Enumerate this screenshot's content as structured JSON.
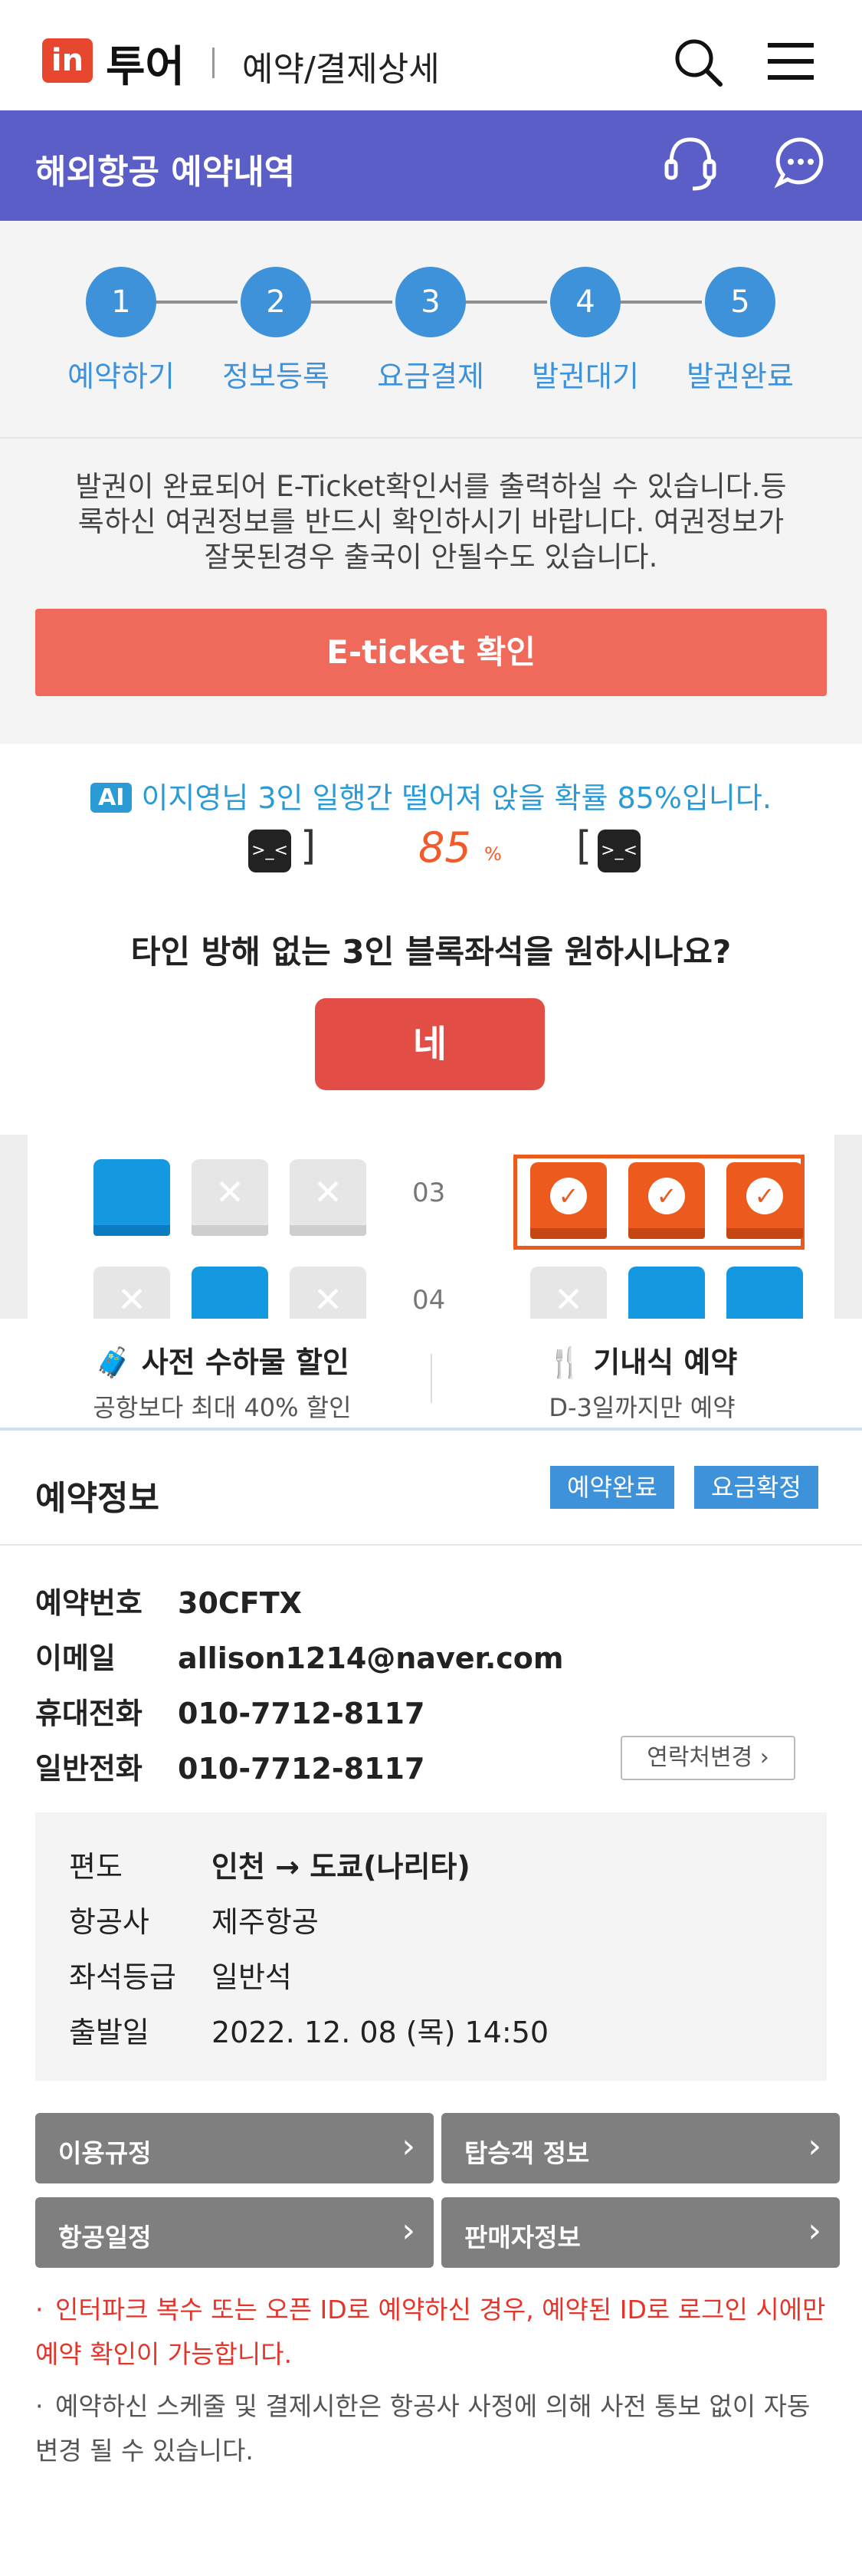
{
  "header": {
    "logo_mark": "in",
    "logo_text": "투어",
    "title": "예약/결제상세"
  },
  "subheader": {
    "title": "해외항공 예약내역"
  },
  "steps": [
    {
      "number": "1",
      "label": "예약하기"
    },
    {
      "number": "2",
      "label": "정보등록"
    },
    {
      "number": "3",
      "label": "요금결제"
    },
    {
      "number": "4",
      "label": "발권대기"
    },
    {
      "number": "5",
      "label": "발권완료"
    }
  ],
  "notice": {
    "line1": "발권이 완료되어 E-Ticket확인서를 출력하실 수 있습니다.등",
    "line2": "록하신 여권정보를 반드시 확인하시기 바랍니다. 여권정보가",
    "line3": "잘못된경우 출국이 안될수도 있습니다.",
    "button": "E-ticket 확인"
  },
  "ai_panel": {
    "badge": "AI",
    "message": "이지영님 3인 일행간 떨어져 앉을 확률  85%입니다.",
    "percent": "85",
    "percent_unit": "%",
    "question": "타인 방해 없는 3인 블록좌석을 원하시나요?",
    "yes_button": "네"
  },
  "seatmap": {
    "rows": [
      "03",
      "04"
    ]
  },
  "extras": [
    {
      "title": "사전 수하물 할인",
      "subtitle": "공항보다 최대 40% 할인"
    },
    {
      "title": "기내식 예약",
      "subtitle": "D-3일까지만 예약"
    }
  ],
  "reservation": {
    "title": "예약정보",
    "badges": [
      "예약완료",
      "요금확정"
    ],
    "fields": [
      {
        "label": "예약번호",
        "value": "30CFTX"
      },
      {
        "label": "이메일",
        "value": "allison1214@naver.com"
      },
      {
        "label": "휴대전화",
        "value": "010-7712-8117"
      },
      {
        "label": "일반전화",
        "value": "010-7712-8117"
      }
    ],
    "contact_change": "연락처변경",
    "flight": [
      {
        "label": "편도",
        "value": "인천 → 도쿄(나리타)"
      },
      {
        "label": "항공사",
        "value": "제주항공"
      },
      {
        "label": "좌석등급",
        "value": "일반석"
      },
      {
        "label": "출발일",
        "value": "2022. 12. 08 (목) 14:50"
      }
    ]
  },
  "links": [
    {
      "label": "이용규정"
    },
    {
      "label": "탑승객 정보"
    },
    {
      "label": "항공일정"
    },
    {
      "label": "판매자정보"
    }
  ],
  "notes": [
    "인터파크 복수 또는 오픈 ID로 예약하신 경우, 예약된 ID로 로그인 시에만 예약 확인이 가능합니다.",
    "예약하신 스케줄 및 결제시한은 항공사 사정에 의해 사전 통보 없이 자동 변경 될 수 있습니다."
  ],
  "colors": {
    "brand_red": "#e8472f",
    "header_purple": "#5b5ec7",
    "step_blue": "#3d92d9",
    "eticket_button": "#f06a5c",
    "yes_button": "#e24e45",
    "seat_blue": "#1498e0",
    "seat_selected": "#ec5a1e",
    "link_button_gray": "#7f7f7f",
    "note_red": "#e5342a"
  },
  "icons": {
    "search": "search-icon",
    "menu": "hamburger-menu-icon",
    "customer_service": "headset-icon",
    "chat": "chat-bubble-icon",
    "baggage": "luggage-icon",
    "meal": "fork-knife-icon",
    "face": "sad-face-icon"
  }
}
